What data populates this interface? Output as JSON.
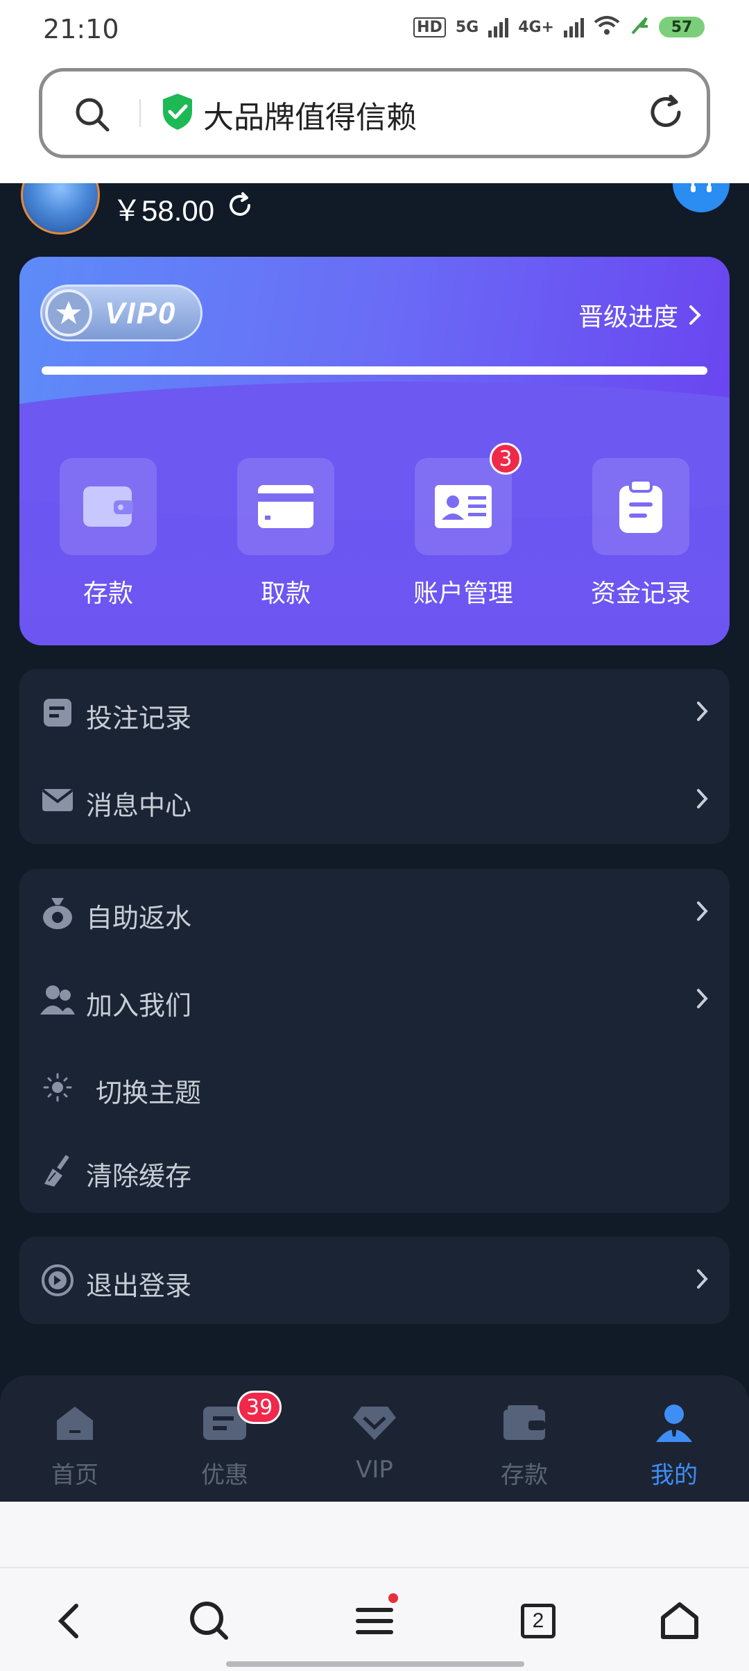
{
  "status_bar": {
    "time": "21:10",
    "hd": "HD",
    "net1": "5G",
    "net2": "4G+",
    "battery": "57"
  },
  "browser": {
    "url_text": "大品牌值得信赖"
  },
  "account": {
    "balance": "￥58.00"
  },
  "vip": {
    "level": "VIP0",
    "progress_label": "晋级进度",
    "progress": 1.0,
    "actions": [
      {
        "label": "存款",
        "icon": "wallet-icon"
      },
      {
        "label": "取款",
        "icon": "card-icon"
      },
      {
        "label": "账户管理",
        "icon": "id-card-icon",
        "badge": "3"
      },
      {
        "label": "资金记录",
        "icon": "clipboard-icon"
      }
    ]
  },
  "menu_group_1": [
    {
      "label": "投注记录",
      "icon": "document-icon"
    },
    {
      "label": "消息中心",
      "icon": "envelope-icon"
    }
  ],
  "menu_group_2": [
    {
      "label": "自助返水",
      "icon": "money-bag-icon"
    },
    {
      "label": "加入我们",
      "icon": "users-icon"
    },
    {
      "label": "切换主题",
      "icon": "sun-icon"
    },
    {
      "label": "清除缓存",
      "icon": "broom-icon"
    }
  ],
  "menu_group_3": [
    {
      "label": "退出登录",
      "icon": "logout-icon"
    }
  ],
  "tabbar": [
    {
      "label": "首页",
      "icon": "home-icon"
    },
    {
      "label": "优惠",
      "icon": "ticket-icon",
      "badge": "39"
    },
    {
      "label": "VIP",
      "icon": "diamond-icon"
    },
    {
      "label": "存款",
      "icon": "wallet-icon"
    },
    {
      "label": "我的",
      "icon": "user-icon",
      "active": true
    }
  ],
  "browser_nav": {
    "tabs_count": "2"
  },
  "colors": {
    "app_bg": "#111a27",
    "card_bg": "#1a2434",
    "vip_purple": "#6d55f2",
    "accent_blue": "#3f8ef6",
    "badge_red": "#f0284a"
  }
}
